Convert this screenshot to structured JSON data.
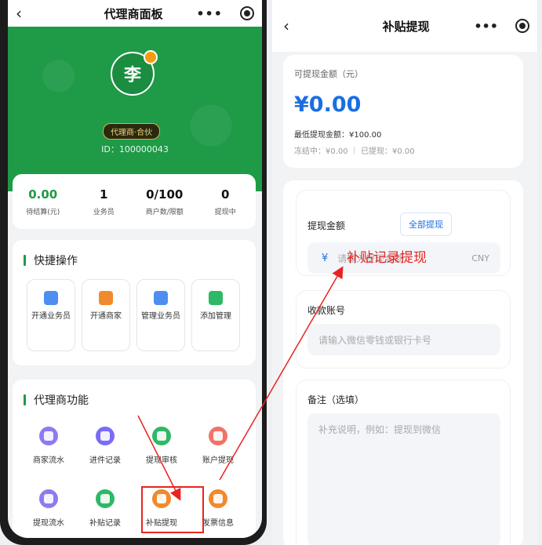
{
  "left": {
    "nav": {
      "back": "‹",
      "title": "代理商面板",
      "more": "•••"
    },
    "profile": {
      "avatar_char": "李",
      "role": "代理商·合伙",
      "id_text": "ID：100000043"
    },
    "stats": [
      {
        "value": "0.00",
        "label": "待结算(元)"
      },
      {
        "value": "1",
        "label": "业务员"
      },
      {
        "value": "0/100",
        "label": "商户数/限额"
      },
      {
        "value": "0",
        "label": "提现中"
      }
    ],
    "quick": {
      "title": "快捷操作",
      "items": [
        {
          "label": "开通业务员",
          "icon": "add-user-icon"
        },
        {
          "label": "开通商家",
          "icon": "wallet-icon"
        },
        {
          "label": "管理业务员",
          "icon": "org-chart-icon"
        },
        {
          "label": "添加管理",
          "icon": "grid-icon"
        }
      ]
    },
    "functions": {
      "title": "代理商功能",
      "items": [
        {
          "label": "商家流水",
          "icon": "bar-chart-icon"
        },
        {
          "label": "进件记录",
          "icon": "refresh-icon"
        },
        {
          "label": "提现审核",
          "icon": "qr-grid-icon"
        },
        {
          "label": "账户提现",
          "icon": "monitor-icon"
        },
        {
          "label": "提现流水",
          "icon": "bar-chart-icon"
        },
        {
          "label": "补贴记录",
          "icon": "wallet-check-icon"
        },
        {
          "label": "补贴提现",
          "icon": "ticket-icon"
        },
        {
          "label": "发票信息",
          "icon": "wallet-icon"
        }
      ]
    }
  },
  "right": {
    "nav": {
      "back": "‹",
      "title": "补贴提现",
      "more": "•••"
    },
    "balance": {
      "label": "可提现金额（元）",
      "amount": "¥0.00",
      "min_line": "最低提现金额：¥100.00",
      "frozen_line": "冻结中：¥0.00 ｜ 已提现：¥0.00"
    },
    "amount_field": {
      "label": "提现金额",
      "all_button": "全部提现",
      "currency_symbol": "¥",
      "placeholder": "请输入提现金额",
      "unit": "CNY"
    },
    "account_field": {
      "label": "收款账号",
      "placeholder": "请输入微信零钱或银行卡号"
    },
    "remark_field": {
      "label": "备注（选填）",
      "placeholder": "补充说明，例如：提现到微信"
    }
  },
  "annotation": {
    "text": "补贴记录提现",
    "color": "#e8241f"
  },
  "colors": {
    "brand_green": "#1f9a47",
    "accent_blue": "#1a6fe0",
    "badge_gold": "#f1d27a"
  }
}
